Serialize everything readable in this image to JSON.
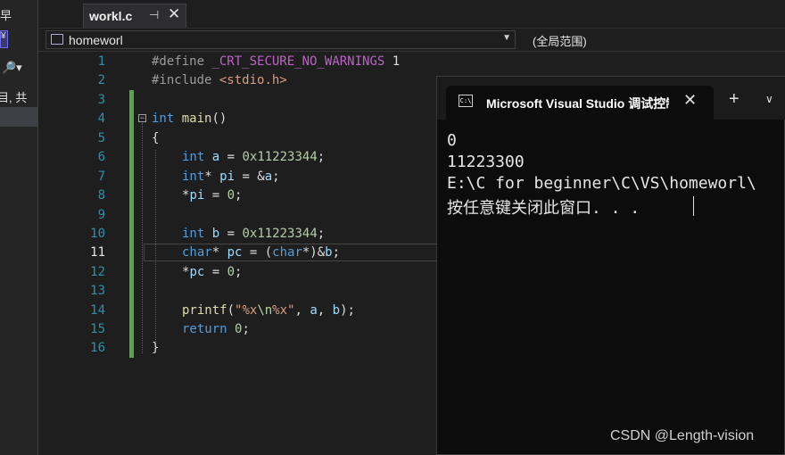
{
  "left_panel": {
    "top_glyph": "早",
    "arrow_glyph": "¥",
    "search_glyph": "🔎▾",
    "text_fragment": "目, 共"
  },
  "tab": {
    "filename": "workl.c",
    "pin": "⊣",
    "close": "✕"
  },
  "navbar": {
    "project": "homeworl",
    "scope": "(全局范围)"
  },
  "editor": {
    "line_numbers": [
      "1",
      "2",
      "3",
      "4",
      "5",
      "6",
      "7",
      "8",
      "9",
      "10",
      "11",
      "12",
      "13",
      "14",
      "15",
      "16"
    ],
    "current_line": "11",
    "lines": {
      "l1": {
        "dir": "#define",
        "macro": "_CRT_SECURE_NO_WARNINGS",
        "val": "1"
      },
      "l2": {
        "dir": "#include",
        "hdr": "<stdio.h>"
      },
      "l4": {
        "kw": "int",
        "fn": "main",
        "rest": "()"
      },
      "l5": "{",
      "l6": {
        "kw": "int",
        "var": "a",
        "eq": " = ",
        "num": "0x11223344",
        "end": ";"
      },
      "l7": {
        "kw": "int",
        "star": "* ",
        "var": "pi",
        "eq": " = &",
        "var2": "a",
        "end": ";"
      },
      "l8": {
        "pre": "*",
        "var": "pi",
        "eq": " = ",
        "num": "0",
        "end": ";"
      },
      "l10": {
        "kw": "int",
        "var": "b",
        "eq": " = ",
        "num": "0x11223344",
        "end": ";"
      },
      "l11": {
        "kw": "char",
        "star": "* ",
        "var": "pc",
        "eq": " = (",
        "kw2": "char",
        "cast": "*)&",
        "var2": "b",
        "end": ";"
      },
      "l12": {
        "pre": "*",
        "var": "pc",
        "eq": " = ",
        "num": "0",
        "end": ";"
      },
      "l14": {
        "fn": "printf",
        "open": "(",
        "s1": "\"%x",
        "esc": "\\n",
        "s2": "%x\"",
        "mid": ", ",
        "a": "a",
        "comma": ", ",
        "b": "b",
        "end": ");"
      },
      "l15": {
        "kw": "return",
        "num": "0",
        "end": ";"
      },
      "l16": "}"
    }
  },
  "console": {
    "title": "Microsoft Visual Studio 调试控制台",
    "icon": "C:\\",
    "close": "✕",
    "plus": "+",
    "dropdown": "∨",
    "output": [
      "0",
      "11223300",
      "E:\\C for beginner\\C\\VS\\homeworl\\",
      "按任意键关闭此窗口. . ."
    ]
  },
  "watermark": "CSDN @Length-vision"
}
